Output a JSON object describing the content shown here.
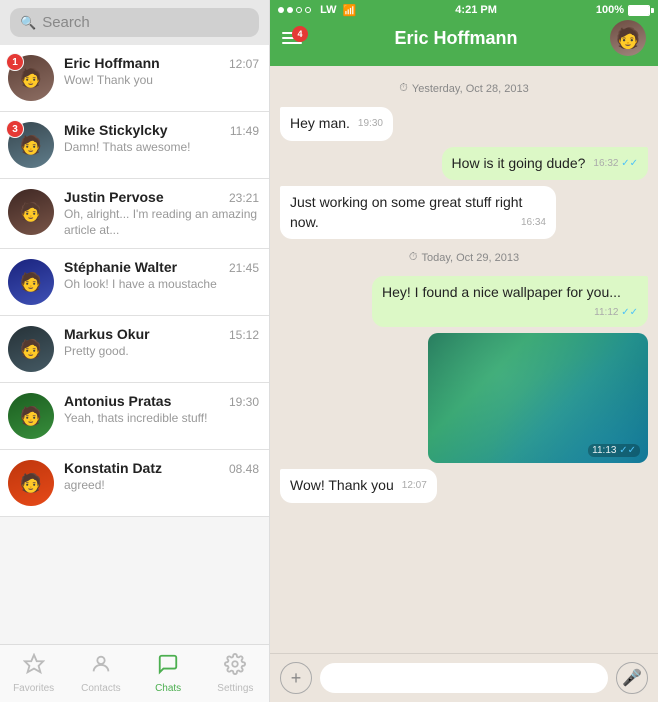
{
  "statusBar": {
    "carrier": "LW",
    "time": "4:21 PM",
    "battery": "100%",
    "wifiIcon": "wifi"
  },
  "search": {
    "placeholder": "Search"
  },
  "chats": [
    {
      "id": 1,
      "name": "Eric Hoffmann",
      "time": "12:07",
      "preview": "Wow! Thank you",
      "badge": 1,
      "avatarClass": "av-eric",
      "avatarEmoji": "👤"
    },
    {
      "id": 2,
      "name": "Mike Stickylcky",
      "time": "11:49",
      "preview": "Damn! Thats awesome!",
      "badge": 3,
      "avatarClass": "av-mike",
      "avatarEmoji": "🕴"
    },
    {
      "id": 3,
      "name": "Justin Pervose",
      "time": "23:21",
      "preview": "Oh, alright... I'm reading an amazing article at...",
      "badge": 0,
      "avatarClass": "av-justin",
      "avatarEmoji": "👤"
    },
    {
      "id": 4,
      "name": "Stéphanie Walter",
      "time": "21:45",
      "preview": "Oh look! I have a moustache",
      "badge": 0,
      "avatarClass": "av-stephanie",
      "avatarEmoji": "👤"
    },
    {
      "id": 5,
      "name": "Markus Okur",
      "time": "15:12",
      "preview": "Pretty good.",
      "badge": 0,
      "avatarClass": "av-markus",
      "avatarEmoji": "👤"
    },
    {
      "id": 6,
      "name": "Antonius Pratas",
      "time": "19:30",
      "preview": "Yeah, thats incredible stuff!",
      "badge": 0,
      "avatarClass": "av-antonius",
      "avatarEmoji": "👤"
    },
    {
      "id": 7,
      "name": "Konstatin Datz",
      "time": "08.48",
      "preview": "agreed!",
      "badge": 0,
      "avatarClass": "av-konstatin",
      "avatarEmoji": "👤"
    }
  ],
  "bottomNav": [
    {
      "id": "favorites",
      "label": "Favorites",
      "icon": "☆",
      "active": false
    },
    {
      "id": "contacts",
      "label": "Contacts",
      "icon": "👤",
      "active": false
    },
    {
      "id": "chats",
      "label": "Chats",
      "icon": "💬",
      "active": true
    },
    {
      "id": "settings",
      "label": "Settings",
      "icon": "⚙",
      "active": false
    }
  ],
  "activeChatHeader": {
    "name": "Eric Hoffmann",
    "menuBadge": "4"
  },
  "messages": [
    {
      "id": 1,
      "type": "date-separator",
      "text": "Yesterday, Oct 28, 2013"
    },
    {
      "id": 2,
      "type": "incoming",
      "text": "Hey man.",
      "time": "19:30",
      "ticks": ""
    },
    {
      "id": 3,
      "type": "outgoing",
      "text": "How is it going dude?",
      "time": "16:32",
      "ticks": "✓✓"
    },
    {
      "id": 4,
      "type": "incoming",
      "text": "Just working on some great stuff right now.",
      "time": "16:34",
      "ticks": ""
    },
    {
      "id": 5,
      "type": "date-separator",
      "text": "Today, Oct 29, 2013"
    },
    {
      "id": 6,
      "type": "outgoing",
      "text": "Hey! I found a nice wallpaper for you...",
      "time": "11:12",
      "ticks": "✓✓"
    },
    {
      "id": 7,
      "type": "image",
      "time": "11:13",
      "ticks": "✓✓"
    },
    {
      "id": 8,
      "type": "incoming",
      "text": "Wow! Thank you",
      "time": "12:07",
      "ticks": ""
    }
  ],
  "inputPlaceholder": ""
}
